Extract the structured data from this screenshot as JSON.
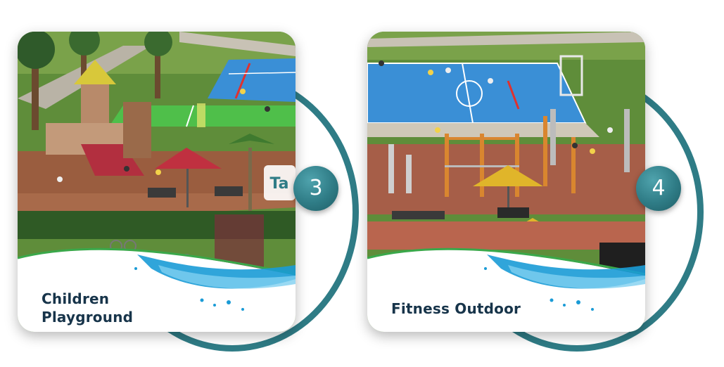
{
  "cards": [
    {
      "number": "3",
      "title_line1": "Children",
      "title_line2": "Playground",
      "sign_text": "Ta"
    },
    {
      "number": "4",
      "title": "Fitness Outdoor"
    }
  ],
  "colors": {
    "accent": "#2f7c86",
    "caption_text": "#17344a",
    "court_blue": "#3a8fd6",
    "court_green": "#4fbf4a",
    "water": "#1a9bd6"
  }
}
